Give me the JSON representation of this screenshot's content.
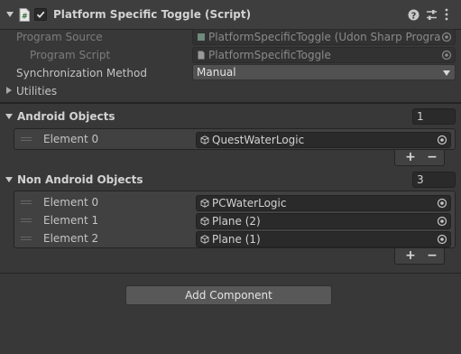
{
  "component": {
    "title": "Platform Specific Toggle (Script)",
    "enabled": true
  },
  "fields": {
    "program_source_label": "Program Source",
    "program_source_value": "PlatformSpecificToggle (Udon Sharp Program A",
    "program_script_label": "Program Script",
    "program_script_value": "PlatformSpecificToggle",
    "sync_method_label": "Synchronization Method",
    "sync_method_value": "Manual",
    "utilities_label": "Utilities"
  },
  "android_objects": {
    "label": "Android Objects",
    "size": "1",
    "elements": [
      {
        "label": "Element 0",
        "value": "QuestWaterLogic"
      }
    ]
  },
  "non_android_objects": {
    "label": "Non Android Objects",
    "size": "3",
    "elements": [
      {
        "label": "Element 0",
        "value": "PCWaterLogic"
      },
      {
        "label": "Element 1",
        "value": "Plane (2)"
      },
      {
        "label": "Element 2",
        "value": "Plane (1)"
      }
    ]
  },
  "list_buttons": {
    "add": "+",
    "remove": "−"
  },
  "add_component_label": "Add Component",
  "colors": {
    "background": "#383838",
    "field": "#2a2a2a",
    "popup": "#515151",
    "text": "#c4c4c4",
    "dim_text": "#7c7c7c"
  },
  "icons": {
    "script": "csharp-script-icon",
    "help": "help-icon",
    "presets": "presets-icon",
    "more": "kebab-menu-icon",
    "object": "cube-icon",
    "target": "object-picker-icon"
  }
}
